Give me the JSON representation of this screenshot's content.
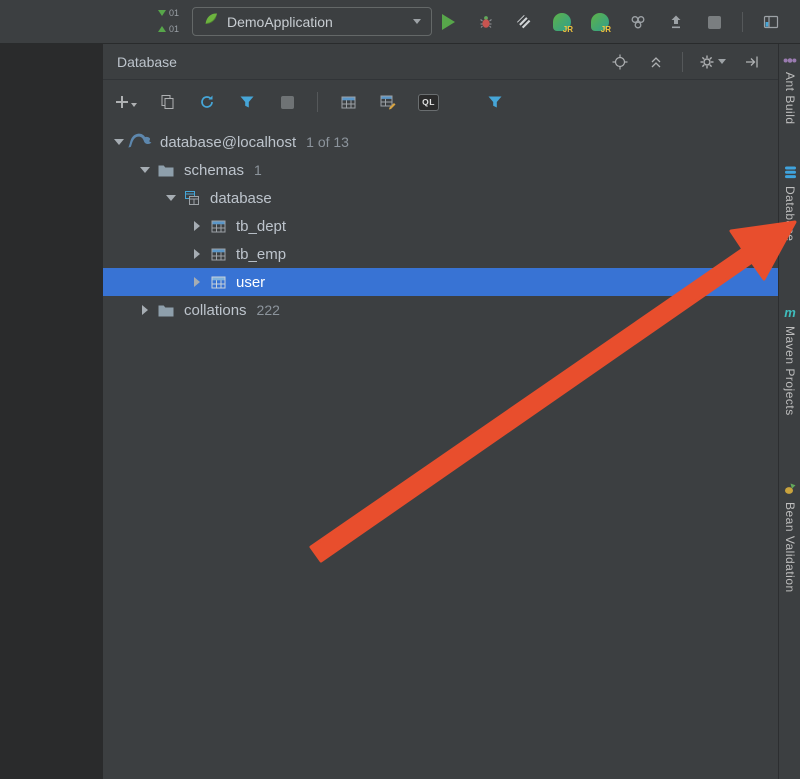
{
  "colors": {
    "panel_bg": "#3c3f41",
    "editor_bg": "#2a2b2c",
    "selection_blue": "#3873d4",
    "accent_blue": "#46a6d8",
    "run_green": "#57a64a",
    "spring_green": "#6db33f",
    "arrow_orange": "#e84e2d"
  },
  "top_toolbar": {
    "vcs_incoming": "01",
    "vcs_outgoing": "01",
    "run_config_label": "DemoApplication",
    "jr_badge": "JR"
  },
  "db_panel": {
    "title": "Database",
    "toolbar": {
      "console_label": "QL"
    },
    "tree": [
      {
        "label": "database@localhost",
        "badge": "1 of 13"
      },
      {
        "label": "schemas",
        "badge": "1"
      },
      {
        "label": "database",
        "badge": ""
      },
      {
        "label": "tb_dept",
        "badge": ""
      },
      {
        "label": "tb_emp",
        "badge": ""
      },
      {
        "label": "user",
        "badge": ""
      },
      {
        "label": "collations",
        "badge": "222"
      }
    ]
  },
  "right_tabs": [
    {
      "label": "Ant Build"
    },
    {
      "label": "Database"
    },
    {
      "label": "Maven Projects"
    },
    {
      "label": "Bean Validation"
    }
  ],
  "maven_icon_letter": "m"
}
